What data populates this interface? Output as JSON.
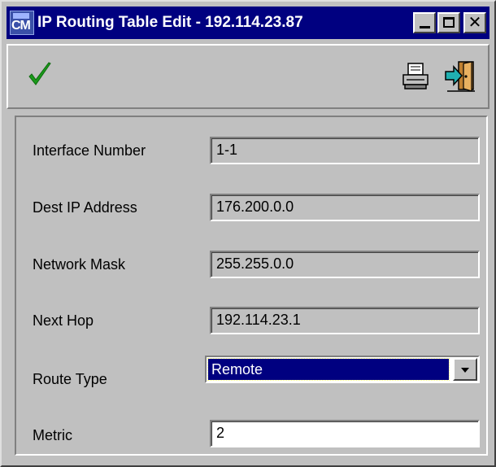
{
  "window": {
    "title": "IP Routing Table Edit - 192.114.23.87",
    "app_icon_text": "CM",
    "controls": {
      "minimize": "minimize-icon",
      "maximize": "maximize-icon",
      "close": "close-icon",
      "close_glyph": "✕"
    }
  },
  "toolbar": {
    "apply_icon": "checkmark-icon",
    "print_icon": "printer-icon",
    "exit_icon": "exit-door-icon"
  },
  "form": {
    "interface_number": {
      "label": "Interface Number",
      "value": "1-1"
    },
    "dest_ip": {
      "label": "Dest IP Address",
      "value": "176.200.0.0"
    },
    "network_mask": {
      "label": "Network Mask",
      "value": "255.255.0.0"
    },
    "next_hop": {
      "label": "Next Hop",
      "value": "192.114.23.1"
    },
    "route_type": {
      "label": "Route Type",
      "value": "Remote"
    },
    "metric": {
      "label": "Metric",
      "value": "2"
    }
  },
  "colors": {
    "titlebar": "#000080",
    "face": "#c0c0c0",
    "check_green": "#1a9a1a",
    "selection": "#000080"
  }
}
